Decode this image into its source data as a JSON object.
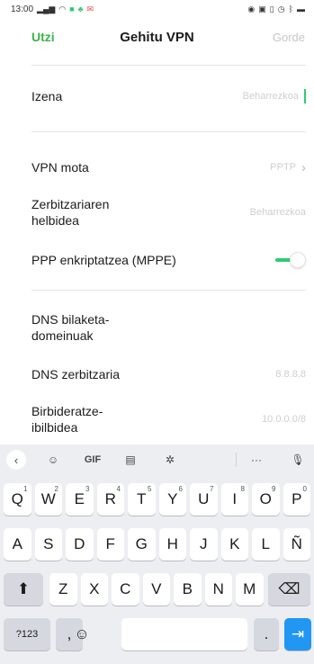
{
  "status_bar": {
    "time": "13:00",
    "left_icons": [
      "signal-icon",
      "wifi-icon",
      "app-notification-icon",
      "app-notification-icon",
      "mail-icon"
    ],
    "right_icons": [
      "nfc-icon",
      "data-icon",
      "vibrate-icon",
      "alarm-icon",
      "bluetooth-icon",
      "battery-icon"
    ]
  },
  "header": {
    "cancel_label": "Utzi",
    "title": "Gehitu VPN",
    "save_label": "Gorde"
  },
  "form": {
    "name": {
      "label": "Izena",
      "placeholder": "Beharrezkoa"
    },
    "vpn_type": {
      "label": "VPN mota",
      "value": "PPTP"
    },
    "server": {
      "label_line1": "Zerbitzariaren",
      "label_line2": "helbidea",
      "placeholder": "Beharrezkoa"
    },
    "mppe": {
      "label": "PPP enkriptatzea (MPPE)",
      "enabled": true
    },
    "dns_search": {
      "label_line1": "DNS bilaketa-",
      "label_line2": "domeinuak"
    },
    "dns_server": {
      "label": "DNS zerbitzaria",
      "placeholder": "8.8.8.8"
    },
    "routes": {
      "label_line1": "Birbideratze-",
      "label_line2": "ibilbidea",
      "placeholder": "10.0.0.0/8"
    }
  },
  "keyboard": {
    "toolbar": {
      "gif_label": "GIF",
      "more_label": "···"
    },
    "row1": [
      {
        "k": "Q",
        "h": "1"
      },
      {
        "k": "W",
        "h": "2"
      },
      {
        "k": "E",
        "h": "3"
      },
      {
        "k": "R",
        "h": "4"
      },
      {
        "k": "T",
        "h": "5"
      },
      {
        "k": "Y",
        "h": "6"
      },
      {
        "k": "U",
        "h": "7"
      },
      {
        "k": "I",
        "h": "8"
      },
      {
        "k": "O",
        "h": "9"
      },
      {
        "k": "P",
        "h": "0"
      }
    ],
    "row2": [
      "A",
      "S",
      "D",
      "F",
      "G",
      "H",
      "J",
      "K",
      "L",
      "Ñ"
    ],
    "row3": [
      "Z",
      "X",
      "C",
      "V",
      "B",
      "N",
      "M"
    ],
    "symbols_label": "?123",
    "comma_label": ",",
    "period_label": "."
  }
}
